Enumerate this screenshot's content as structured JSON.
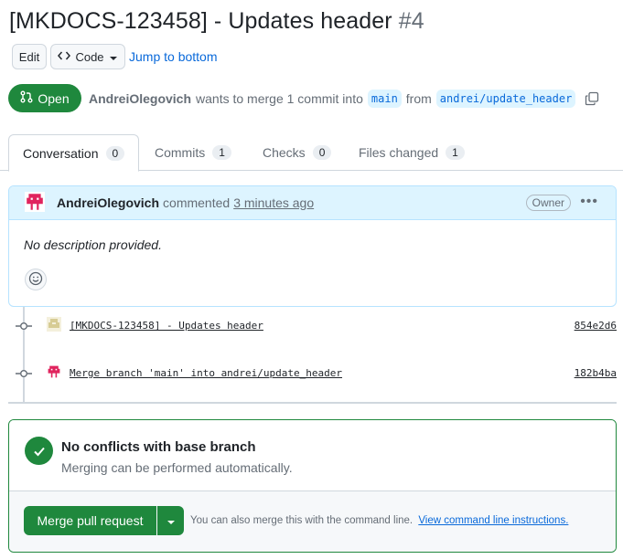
{
  "pr": {
    "title": "[MKDOCS-123458] - Updates header",
    "number": "#4",
    "state": "Open",
    "author": "AndreiOlegovich",
    "summary": "wants to merge 1 commit into",
    "base_branch": "main",
    "from_label": "from",
    "head_branch": "andrei/update_header"
  },
  "toolbar": {
    "edit_label": "Edit",
    "code_label": "Code",
    "jump_label": "Jump to bottom"
  },
  "tabs": [
    {
      "label": "Conversation",
      "count": "0"
    },
    {
      "label": "Commits",
      "count": "1"
    },
    {
      "label": "Checks",
      "count": "0"
    },
    {
      "label": "Files changed",
      "count": "1"
    }
  ],
  "comment": {
    "author": "AndreiOlegovich",
    "action": "commented",
    "time": "3 minutes ago",
    "badge": "Owner",
    "body": "No description provided."
  },
  "commits": [
    {
      "message": "[MKDOCS-123458] - Updates header",
      "sha": "854e2d6"
    },
    {
      "message": "Merge branch 'main' into andrei/update_header",
      "sha": "182b4ba"
    }
  ],
  "merge": {
    "title": "No conflicts with base branch",
    "subtitle": "Merging can be performed automatically.",
    "button_label": "Merge pull request",
    "hint_text": "You can also merge this with the command line.",
    "hint_link": "View command line instructions."
  },
  "colors": {
    "open_green": "#1f883d",
    "link_blue": "#0969da",
    "comment_header_bg": "#ddf4ff",
    "avatar_red": "#e0245e"
  }
}
